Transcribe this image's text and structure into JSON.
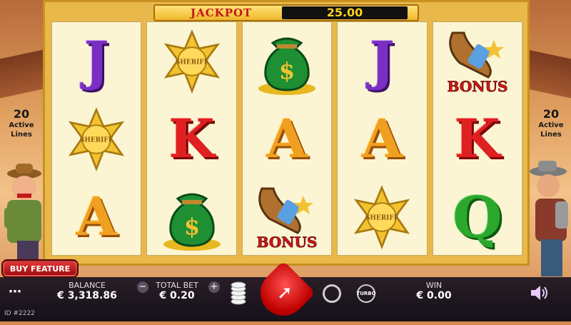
{
  "jackpot": {
    "label": "JACKPOT",
    "value": "25.00"
  },
  "side_left": {
    "count": "20",
    "label_line1": "Active",
    "label_line2": "Lines"
  },
  "side_right": {
    "count": "20",
    "label_line1": "Active",
    "label_line2": "Lines"
  },
  "reels": [
    {
      "symbols": [
        "J",
        "sheriff-badge",
        "A"
      ]
    },
    {
      "symbols": [
        "sheriff-badge",
        "K",
        "money-bag"
      ]
    },
    {
      "symbols": [
        "money-bag",
        "A",
        "holster-bonus"
      ]
    },
    {
      "symbols": [
        "J",
        "A",
        "sheriff-badge"
      ]
    },
    {
      "symbols": [
        "holster-bonus",
        "K",
        "Q"
      ]
    }
  ],
  "symbol_text": {
    "sheriff": "SHERIFF",
    "bonus": "BONUS",
    "dollar": "$"
  },
  "buy_feature": "BUY FEATURE",
  "menu_icon": "ellipsis-icon",
  "balance": {
    "label": "BALANCE",
    "value": "€ 3,318.86"
  },
  "total_bet": {
    "label": "TOTAL BET",
    "value": "€ 0.20"
  },
  "turbo_label": "TURBO",
  "win": {
    "label": "WIN",
    "value": "€ 0.00"
  },
  "id_text": "ID #2222",
  "colors": {
    "accent_red": "#d01818",
    "gold": "#e9b84a",
    "bar_bg": "#1c1620"
  }
}
